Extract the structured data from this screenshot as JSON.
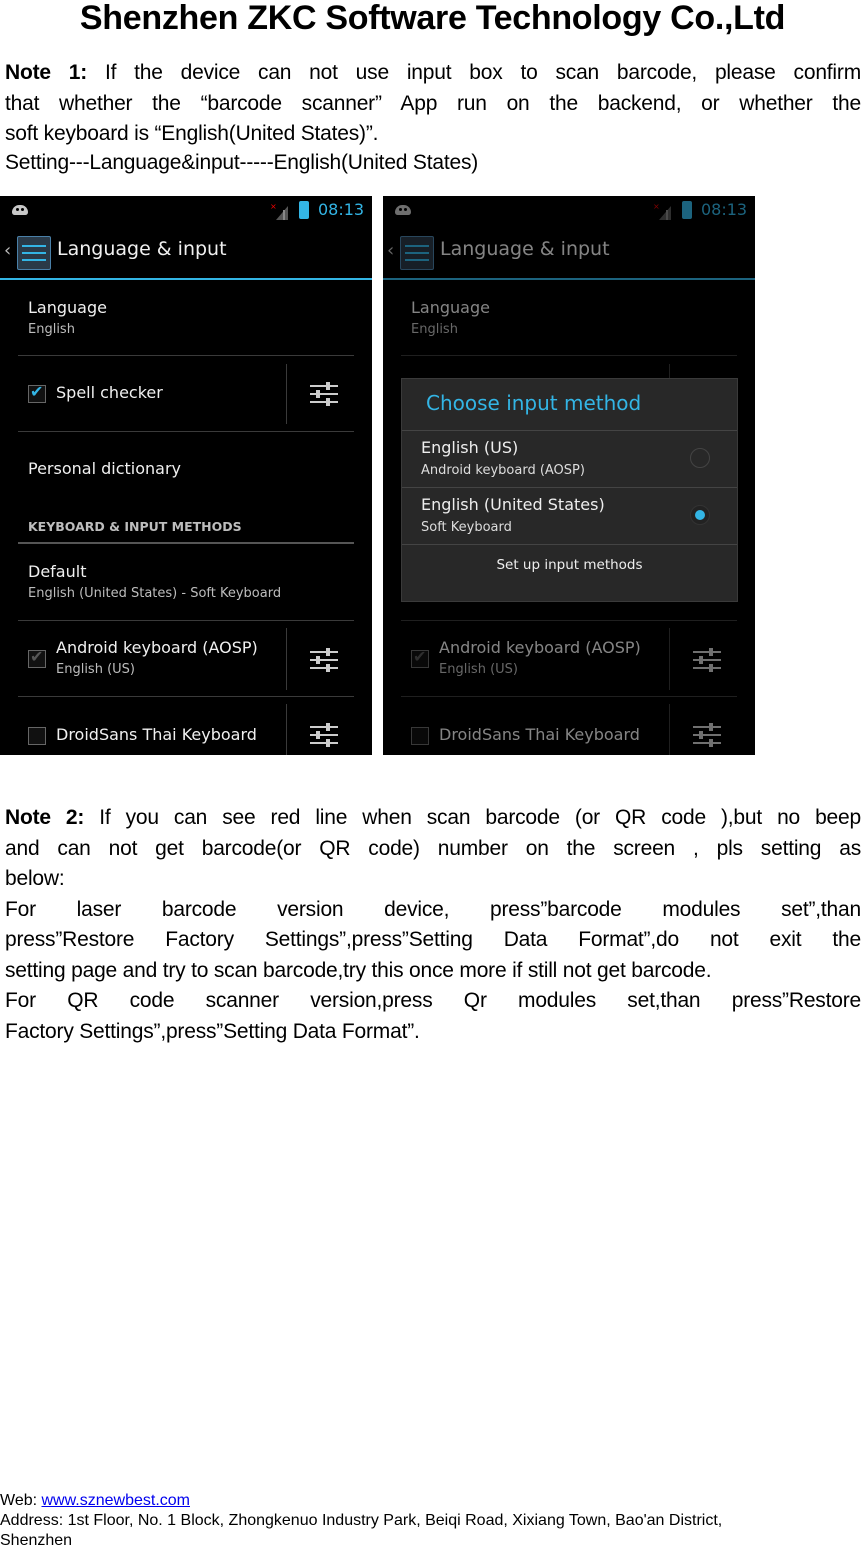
{
  "document": {
    "title": "Shenzhen ZKC Software Technology Co.,Ltd",
    "note1": {
      "label": "Note 1:",
      "text_line1": " If the device can not use input box to scan barcode, please confirm",
      "text_line2": "that whether the “barcode scanner” App run on the backend, or whether the",
      "text_line3": "soft keyboard is “English(United States)”.",
      "path": "Setting---Language&input-----English(United States)"
    },
    "note2": {
      "label": "Note 2:",
      "text_line1": " If you can see red line when scan barcode (or QR code ),but no beep",
      "text_line2": "and can not get barcode(or QR code) number on the screen , pls setting as",
      "text_line3": "below:",
      "laser_line1": "For laser barcode version device, press”barcode modules set”,than",
      "laser_line2": "press”Restore Factory Settings”,press”Setting Data Format”,do not exit the",
      "laser_line3": "setting page and try to scan barcode,try this once more if still not get barcode.",
      "qr_line1": "For QR code scanner version,press Qr modules set,than press”Restore",
      "qr_line2": "Factory Settings”,press”Setting Data Format”."
    },
    "footer": {
      "web_label": "Web: ",
      "web_link": "www.sznewbest.com",
      "address_line1": "Address: 1st Floor, No. 1 Block, Zhongkenuo Industry Park, Beiqi Road, Xixiang Town, Bao'an District,",
      "address_line2": "Shenzhen"
    }
  },
  "screenshots": {
    "status_bar": {
      "time": "08:13"
    },
    "action_bar": {
      "title": "Language & input"
    },
    "settings": {
      "language": {
        "title": "Language",
        "value": "English"
      },
      "spell_checker": {
        "label": "Spell checker",
        "checked": true
      },
      "personal_dictionary": {
        "label": "Personal dictionary"
      },
      "section_header": "KEYBOARD & INPUT METHODS",
      "default": {
        "title": "Default",
        "value": "English (United States) - Soft Keyboard"
      },
      "android_keyboard": {
        "title": "Android keyboard (AOSP)",
        "subtitle": "English (US)",
        "checked": true,
        "enabled": false
      },
      "droidsans_thai": {
        "title": "DroidSans Thai Keyboard",
        "checked": false
      }
    },
    "dialog": {
      "title": "Choose input method",
      "options": [
        {
          "title": "English (US)",
          "subtitle": "Android keyboard (AOSP)",
          "selected": false
        },
        {
          "title": "English (United States)",
          "subtitle": "Soft Keyboard",
          "selected": true
        }
      ],
      "button": "Set up input methods"
    },
    "colors": {
      "accent": "#33b5e5",
      "background": "#000000",
      "dialog": "#282828"
    }
  }
}
